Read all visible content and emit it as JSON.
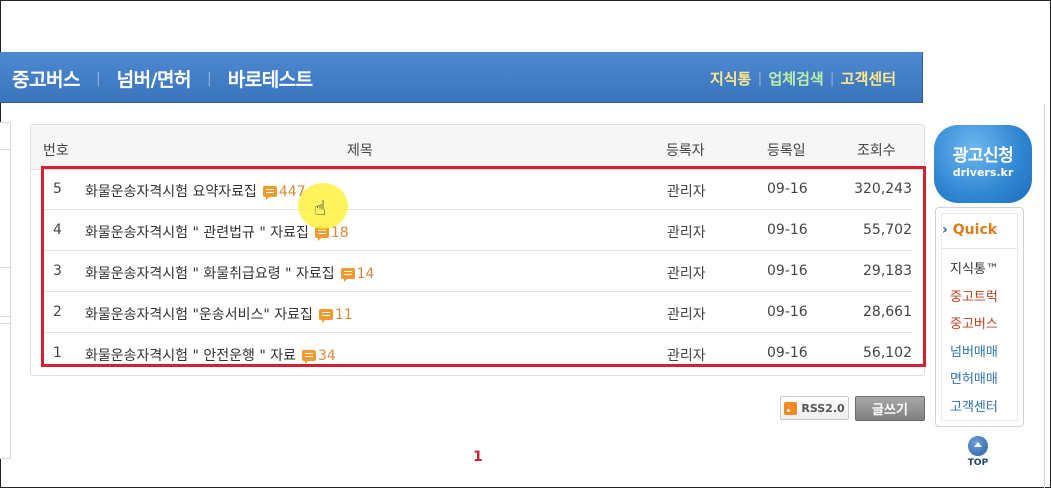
{
  "nav": {
    "left": [
      "중고버스",
      "넘버/면허",
      "바로테스트"
    ],
    "right": [
      "지식통",
      "업체검색",
      "고객센터"
    ]
  },
  "board": {
    "headers": {
      "no": "번호",
      "title": "제목",
      "writer": "등록자",
      "date": "등록일",
      "views": "조회수"
    },
    "rows": [
      {
        "no": "5",
        "title": "화물운송자격시험 요약자료집",
        "comments": "447",
        "writer": "관리자",
        "date": "09-16",
        "views": "320,243"
      },
      {
        "no": "4",
        "title": "화물운송자격시험 \" 관련법규 \" 자료집",
        "comments": "18",
        "writer": "관리자",
        "date": "09-16",
        "views": "55,702"
      },
      {
        "no": "3",
        "title": "화물운송자격시험 \" 화물취급요령 \" 자료집",
        "comments": "14",
        "writer": "관리자",
        "date": "09-16",
        "views": "29,183"
      },
      {
        "no": "2",
        "title": "화물운송자격시험 \"운송서비스\" 자료집",
        "comments": "11",
        "writer": "관리자",
        "date": "09-16",
        "views": "28,661"
      },
      {
        "no": "1",
        "title": "화물운송자격시험 \" 안전운행 \" 자료",
        "comments": "34",
        "writer": "관리자",
        "date": "09-16",
        "views": "56,102"
      }
    ]
  },
  "buttons": {
    "rss": "RSS2.0",
    "write": "글쓰기"
  },
  "pagination": {
    "current": "1"
  },
  "sidebar": {
    "ad_title": "광고신청",
    "ad_domain": "drivers.kr",
    "quick_title": "Quick",
    "quick_links": [
      "지식통™",
      "중고트럭",
      "중고버스",
      "넘버매매",
      "면허매매",
      "고객센터"
    ],
    "top_label": "TOP"
  },
  "colors": {
    "nav_bar": "#3f7cc6",
    "highlight": "#d7202f",
    "comment_count": "#d98a3a",
    "page_active": "#c0282e"
  }
}
